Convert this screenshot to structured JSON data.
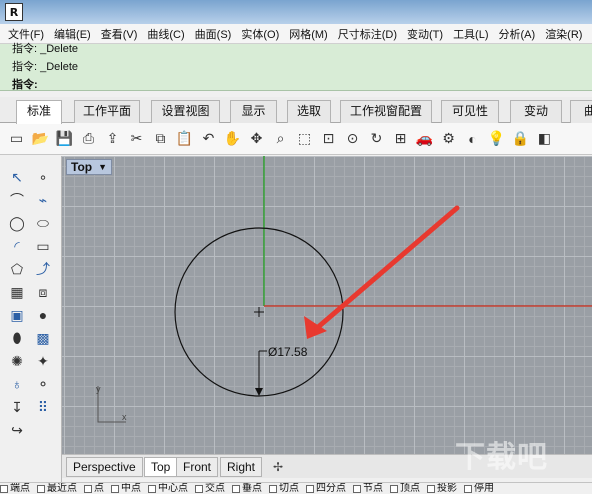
{
  "menu": {
    "items": [
      "文件(F)",
      "编辑(E)",
      "查看(V)",
      "曲线(C)",
      "曲面(S)",
      "实体(O)",
      "网格(M)",
      "尺寸标注(D)",
      "变动(T)",
      "工具(L)",
      "分析(A)",
      "渲染(R)"
    ]
  },
  "command": {
    "line1": "指令: _Delete",
    "line2": "指令: _Delete",
    "prompt": "指令:"
  },
  "tabs": [
    "标准",
    "工作平面",
    "设置视图",
    "显示",
    "选取",
    "工作视窗配置",
    "可见性",
    "变动",
    "曲线"
  ],
  "active_tab": "标准",
  "toolbar_icons": [
    "new-icon",
    "open-icon",
    "save-icon",
    "print-icon",
    "import-icon",
    "cut-icon",
    "copy-icon",
    "paste-icon",
    "undo-icon",
    "pan-icon",
    "rotate-view-icon",
    "zoom-icon",
    "zoom-window-icon",
    "zoom-extents-icon",
    "zoom-selected-icon",
    "rotate-camera-icon",
    "four-views-icon",
    "car-icon",
    "properties-icon",
    "shade-icon",
    "light-icon",
    "lock-icon",
    "layer-icon"
  ],
  "viewport": {
    "label": "Top",
    "dimension_text": "Ø17.58",
    "axis_y": "y",
    "axis_x": "x"
  },
  "viewport_tabs": [
    "Perspective",
    "Top",
    "Front",
    "Right"
  ],
  "active_viewport_tab": "Top",
  "osnaps": [
    "端点",
    "最近点",
    "点",
    "中点",
    "中心点",
    "交点",
    "垂点",
    "切点",
    "四分点",
    "节点",
    "顶点",
    "投影",
    "停用"
  ],
  "colors": {
    "command_bg": "#d8ecd6",
    "viewport_bg": "#9a9fa5",
    "x_axis": "#c0392b",
    "y_axis": "#2e9b2e",
    "arrow": "#e8392f"
  }
}
